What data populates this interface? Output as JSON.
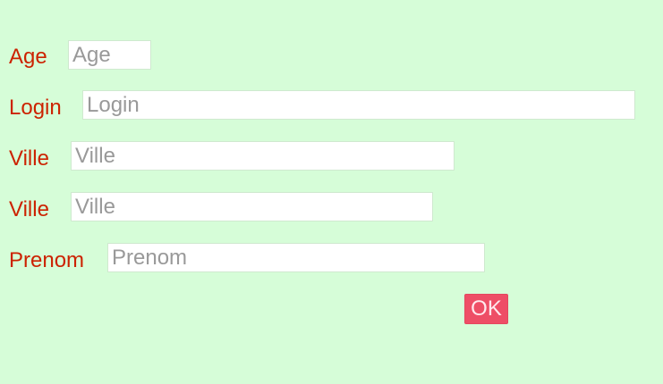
{
  "form": {
    "fields": [
      {
        "label": "Age",
        "placeholder": "Age",
        "value": ""
      },
      {
        "label": "Login",
        "placeholder": "Login",
        "value": ""
      },
      {
        "label": "Ville",
        "placeholder": "Ville",
        "value": ""
      },
      {
        "label": "Ville",
        "placeholder": "Ville",
        "value": ""
      },
      {
        "label": "Prenom",
        "placeholder": "Prenom",
        "value": ""
      }
    ],
    "submit_label": "OK"
  },
  "colors": {
    "background": "#d6fdd8",
    "label": "#cc2200",
    "button": "#ee4e66",
    "button_text": "#ffe9ee"
  }
}
